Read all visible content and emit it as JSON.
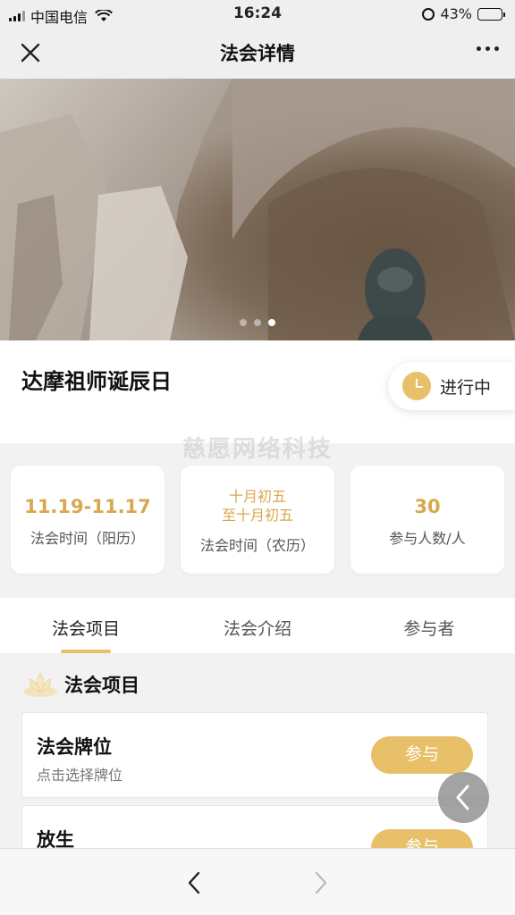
{
  "status_bar": {
    "carrier": "中国电信",
    "time": "16:24",
    "battery_percent": "43%",
    "battery_level": 0.43
  },
  "nav": {
    "title": "法会详情",
    "close_icon": "close-icon",
    "more_icon": "more-icon"
  },
  "hero": {
    "carousel_total": 3,
    "carousel_active": 3
  },
  "event": {
    "title": "达摩祖师诞辰日",
    "status": "进行中",
    "watermark": "慈愿网络科技"
  },
  "stats": [
    {
      "value": "11.19-11.17",
      "label": "法会时间（阳历）"
    },
    {
      "value_line1": "十月初五",
      "value_line2": "至十月初五",
      "label": "法会时间（农历）"
    },
    {
      "value": "30",
      "label": "参与人数/人"
    }
  ],
  "tabs": [
    {
      "label": "法会项目",
      "active": true
    },
    {
      "label": "法会介绍",
      "active": false
    },
    {
      "label": "参与者",
      "active": false
    }
  ],
  "section": {
    "title": "法会项目"
  },
  "items": [
    {
      "name": "法会牌位",
      "subtitle": "点击选择牌位",
      "button": "参与"
    },
    {
      "name": "放生",
      "subtitle": "",
      "button": "参与"
    }
  ],
  "colors": {
    "accent": "#e8c06a",
    "accent_text": "#d7a94e",
    "background": "#f2f2f2"
  }
}
